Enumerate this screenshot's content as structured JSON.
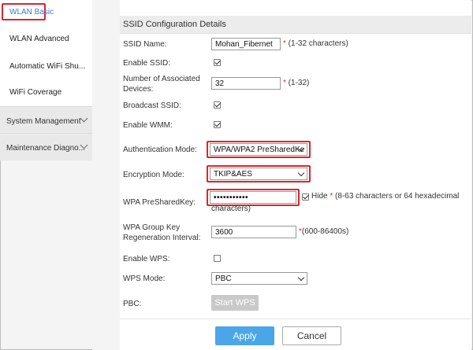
{
  "sidebar": {
    "items": [
      {
        "label": "WLAN Basic"
      },
      {
        "label": "WLAN Advanced"
      },
      {
        "label": "Automatic WiFi Shu..."
      },
      {
        "label": "WiFi Coverage"
      }
    ],
    "groups": [
      {
        "label": "System Management"
      },
      {
        "label": "Maintenance Diagno..."
      }
    ]
  },
  "section": {
    "title": "SSID Configuration Details"
  },
  "form": {
    "ssid_name": {
      "label": "SSID Name:",
      "value": "Mohan_Fibernet",
      "hint": "(1-32 characters)"
    },
    "enable_ssid": {
      "label": "Enable SSID:",
      "checked": true
    },
    "associated_devices": {
      "label": "Number of Associated Devices:",
      "value": "32",
      "hint": "(1-32)"
    },
    "broadcast_ssid": {
      "label": "Broadcast SSID:",
      "checked": true
    },
    "enable_wmm": {
      "label": "Enable WMM:",
      "checked": true
    },
    "auth_mode": {
      "label": "Authentication Mode:",
      "value": "WPA/WPA2 PreSharedKe"
    },
    "encryption_mode": {
      "label": "Encryption Mode:",
      "value": "TKIP&AES"
    },
    "wpa_key": {
      "label": "WPA PreSharedKey:",
      "value": "•••••••••••",
      "hide_label": "Hide",
      "hint_line1": "(8-63 characters or 64 hexadecimal",
      "hint_line2": "characters)"
    },
    "group_key_interval": {
      "label": "WPA Group Key Regeneration Interval:",
      "value": "3600",
      "hint": "(600-86400s)"
    },
    "enable_wps": {
      "label": "Enable WPS:",
      "checked": false
    },
    "wps_mode": {
      "label": "WPS Mode:",
      "value": "PBC"
    },
    "pbc": {
      "label": "PBC:",
      "button": "Start WPS"
    }
  },
  "actions": {
    "apply": "Apply",
    "cancel": "Cancel"
  },
  "colors": {
    "highlight": "#d9262c",
    "accent": "#4aa6e8",
    "link": "#3a7bd5"
  }
}
